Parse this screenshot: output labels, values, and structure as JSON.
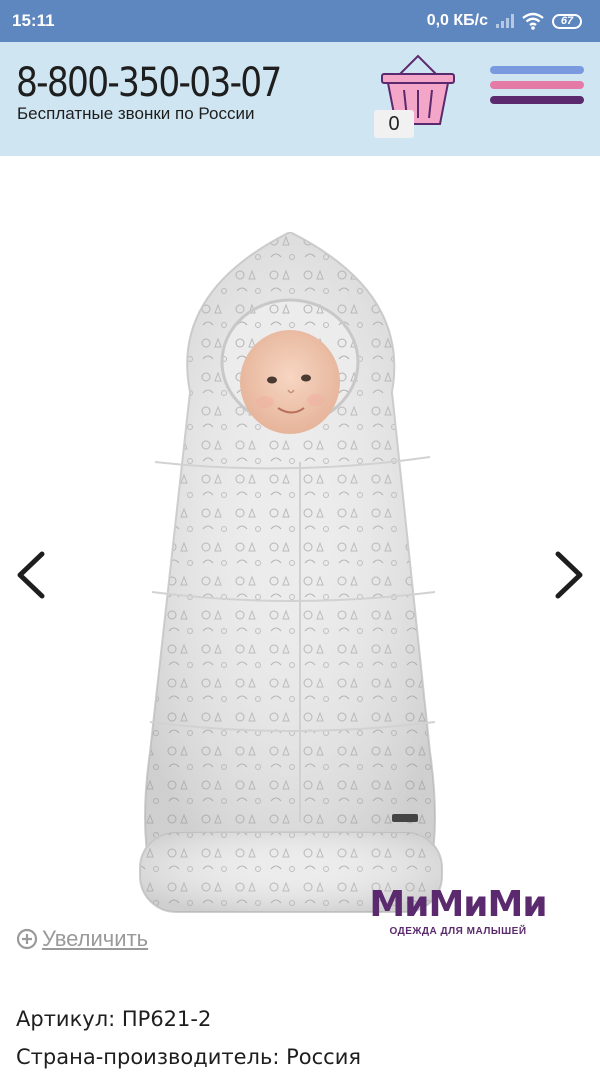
{
  "status_bar": {
    "time": "15:11",
    "net_speed": "0,0 КБ/с",
    "battery": "67"
  },
  "header": {
    "phone": "8-800-350-03-07",
    "subtitle": "Бесплатные звонки по России",
    "cart_count": "0",
    "menu_colors": [
      "#7a9ae0",
      "#e67aa6",
      "#5b2a6e"
    ]
  },
  "gallery": {
    "brand_name": "МиМиМи",
    "brand_tagline": "ОДЕЖДА ДЛЯ МАЛЫШЕЙ",
    "zoom_label": "Увеличить"
  },
  "product": {
    "article": "Артикул: ПР621-2",
    "country": "Страна-производитель: Россия"
  },
  "colors": {
    "status_bar": "#5e86bf",
    "header_bg": "#cfe6f2",
    "cart_pink": "#f3a6c8",
    "brand": "#5b2a6e"
  }
}
